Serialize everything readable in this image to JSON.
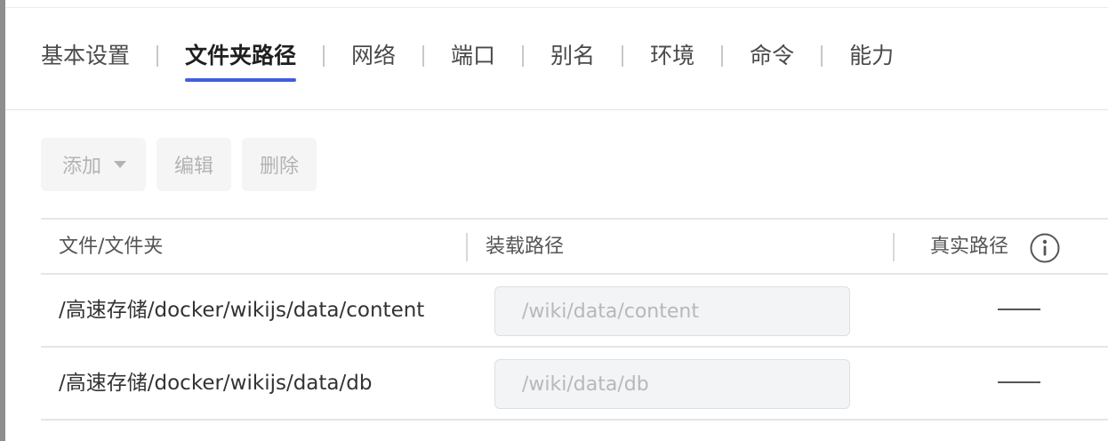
{
  "tabs": [
    {
      "label": "基本设置",
      "active": false
    },
    {
      "label": "文件夹路径",
      "active": true
    },
    {
      "label": "网络",
      "active": false
    },
    {
      "label": "端口",
      "active": false
    },
    {
      "label": "别名",
      "active": false
    },
    {
      "label": "环境",
      "active": false
    },
    {
      "label": "命令",
      "active": false
    },
    {
      "label": "能力",
      "active": false
    }
  ],
  "toolbar": {
    "add_label": "添加",
    "edit_label": "编辑",
    "delete_label": "删除"
  },
  "table": {
    "headers": [
      "文件/文件夹",
      "装载路径",
      "真实路径"
    ],
    "rows": [
      {
        "path": "/高速存储/docker/wikijs/data/content",
        "mount_placeholder": "/wiki/data/content",
        "real_path": "——"
      },
      {
        "path": "/高速存储/docker/wikijs/data/db",
        "mount_placeholder": "/wiki/data/db",
        "real_path": "——"
      }
    ]
  },
  "accent_color": "#3f5fe0"
}
